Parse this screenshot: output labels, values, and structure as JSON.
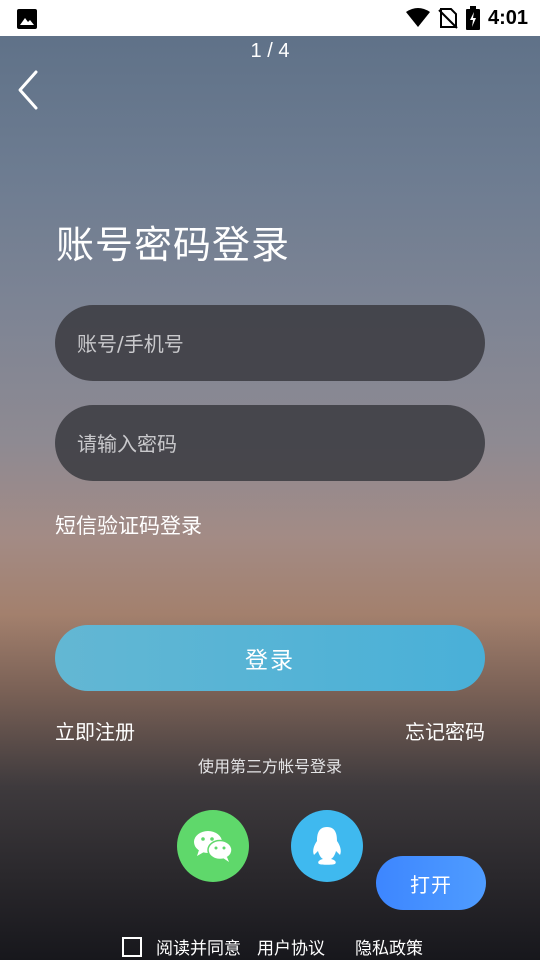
{
  "status_bar": {
    "time": "4:01"
  },
  "pager": {
    "text": "1 / 4"
  },
  "login": {
    "title": "账号密码登录",
    "account_placeholder": "账号/手机号",
    "password_placeholder": "请输入密码",
    "sms_login": "短信验证码登录",
    "login_button": "登录",
    "register": "立即注册",
    "forgot_password": "忘记密码",
    "third_party_label": "使用第三方帐号登录"
  },
  "social": [
    {
      "icon": "wechat-icon",
      "color": "#5fd86b"
    },
    {
      "icon": "qq-icon",
      "color": "#3fb9ef"
    }
  ],
  "open_button": "打开",
  "agreement": {
    "checked": false,
    "read_agree": "阅读并同意",
    "user_agreement": "用户协议",
    "privacy_policy": "隐私政策"
  }
}
